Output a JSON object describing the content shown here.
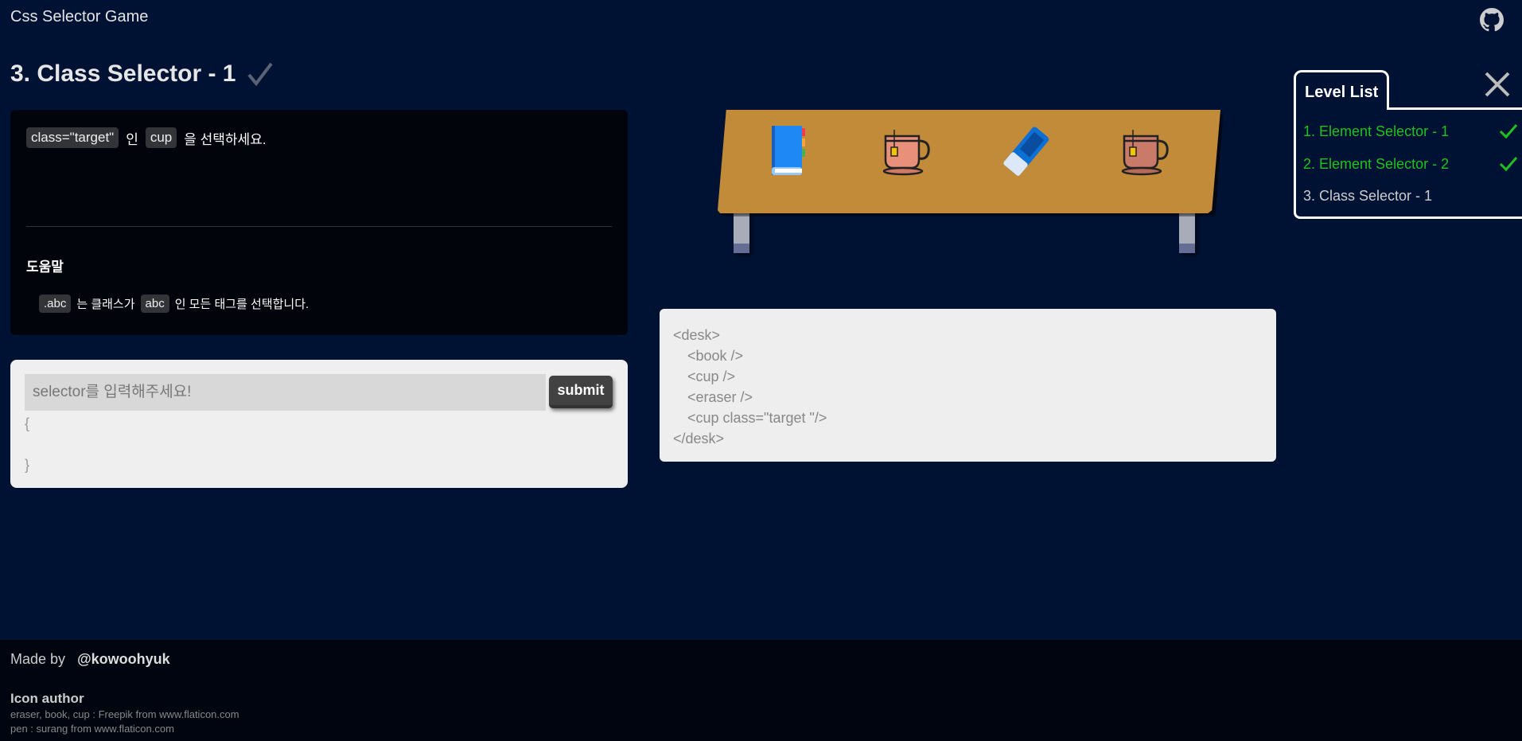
{
  "header": {
    "title": "Css Selector Game",
    "github_icon": "github-icon"
  },
  "level": {
    "title": "3. Class Selector - 1",
    "solved_icon": "check-icon"
  },
  "instruction": {
    "chip1": "class=\"target\"",
    "word1": "인",
    "chip2": "cup",
    "rest": "을 선택하세요.",
    "help_title": "도움말",
    "hint_chip1": ".abc",
    "hint_text1": "는 클래스가",
    "hint_chip2": "abc",
    "hint_text2": "인 모든 태그를 선택합니다."
  },
  "input": {
    "placeholder": "selector를 입력해주세요!",
    "value": "",
    "submit_label": "submit",
    "open_brace": "{",
    "close_brace": "}"
  },
  "desk": {
    "items": [
      "book",
      "cup",
      "eraser",
      "cup"
    ],
    "color": "#c28b3a"
  },
  "code": {
    "lines": [
      "<desk>",
      "<book />",
      "<cup />",
      "<eraser />",
      "<cup class=\"target \"/>",
      "</desk>"
    ]
  },
  "level_list": {
    "title": "Level List",
    "close_icon": "close-icon",
    "items": [
      {
        "label": "1. Element Selector - 1",
        "done": true
      },
      {
        "label": "2. Element Selector - 2",
        "done": true
      },
      {
        "label": "3. Class Selector - 1",
        "done": false
      }
    ],
    "done_color": "#1ec21e"
  },
  "footer": {
    "made_by": "Made by",
    "author": "@kowoohyuk",
    "icon_author_title": "Icon author",
    "credit1_items": "eraser, book, cup : ",
    "credit1_author": "Freepik",
    "credit1_from": " from www.flaticon.com",
    "credit2_items": "pen : ",
    "credit2_author": "surang",
    "credit2_from": " from www.flaticon.com"
  }
}
